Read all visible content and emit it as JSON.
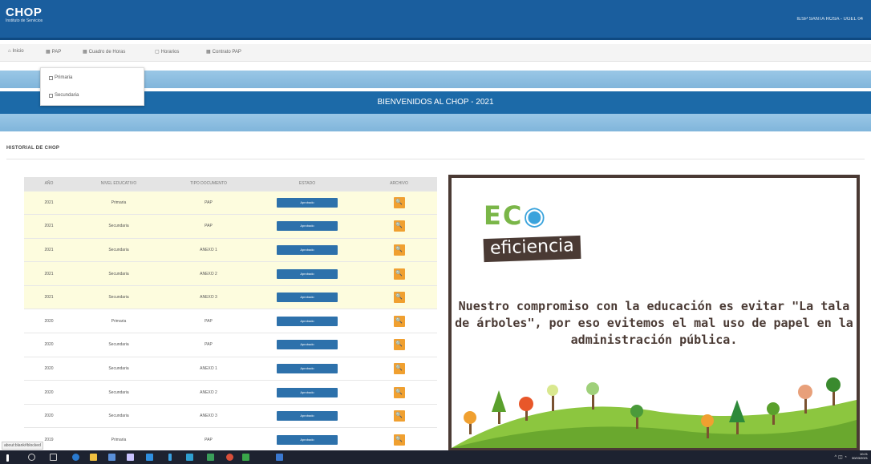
{
  "header": {
    "brand": "CHOP",
    "brand_sub": "Instituto de Servicios",
    "user": "IESP SANTA ROSA - UGEL 04"
  },
  "menu": [
    {
      "label": "Inicio",
      "icon": "home-icon"
    },
    {
      "label": "PAP",
      "icon": "grid-icon"
    },
    {
      "label": "Cuadro de Horas",
      "icon": "grid-icon"
    },
    {
      "label": "Horarios",
      "icon": "calendar-icon"
    },
    {
      "label": "Contrato PAP",
      "icon": "grid-icon"
    }
  ],
  "dropdown": {
    "items": [
      "Primaria",
      "Secundaria"
    ]
  },
  "welcome": "BIENVENIDOS AL CHOP - 2021",
  "history": {
    "title": "HISTORIAL DE CHOP",
    "columns": [
      "AÑO",
      "NIVEL EDUCATIVO",
      "TIPO DOCUMENTO",
      "ESTADO",
      "ARCHIVO"
    ],
    "rows": [
      {
        "year": "2021",
        "level": "Primaria",
        "doc": "PAP",
        "state": "Aprobado",
        "highlight": true
      },
      {
        "year": "2021",
        "level": "Secundaria",
        "doc": "PAP",
        "state": "Aprobado",
        "highlight": true
      },
      {
        "year": "2021",
        "level": "Secundaria",
        "doc": "ANEXO 1",
        "state": "Aprobado",
        "highlight": true
      },
      {
        "year": "2021",
        "level": "Secundaria",
        "doc": "ANEXO 2",
        "state": "Aprobado",
        "highlight": true
      },
      {
        "year": "2021",
        "level": "Secundaria",
        "doc": "ANEXO 3",
        "state": "Aprobado",
        "highlight": true
      },
      {
        "year": "2020",
        "level": "Primaria",
        "doc": "PAP",
        "state": "Aprobado",
        "highlight": false
      },
      {
        "year": "2020",
        "level": "Secundaria",
        "doc": "PAP",
        "state": "Aprobado",
        "highlight": false
      },
      {
        "year": "2020",
        "level": "Secundaria",
        "doc": "ANEXO 1",
        "state": "Aprobado",
        "highlight": false
      },
      {
        "year": "2020",
        "level": "Secundaria",
        "doc": "ANEXO 2",
        "state": "Aprobado",
        "highlight": false
      },
      {
        "year": "2020",
        "level": "Secundaria",
        "doc": "ANEXO 3",
        "state": "Aprobado",
        "highlight": false
      },
      {
        "year": "2019",
        "level": "Primaria",
        "doc": "PAP",
        "state": "Aprobado",
        "highlight": false
      }
    ]
  },
  "eco": {
    "logo_e": "E",
    "logo_c": "C",
    "logo_sub": "eficiencia",
    "message": "Nuestro compromiso con la educación es evitar \"La tala de árboles\", por eso evitemos el mal uso de papel en la administración pública."
  },
  "status_bar": "about:blank#blocked",
  "clock": {
    "time": "10:21",
    "date": "30/03/2021"
  },
  "colors": {
    "header": "#1a5e9e",
    "badge": "#2d71ab",
    "file": "#f0a030",
    "eco_frame": "#4a3a34"
  }
}
